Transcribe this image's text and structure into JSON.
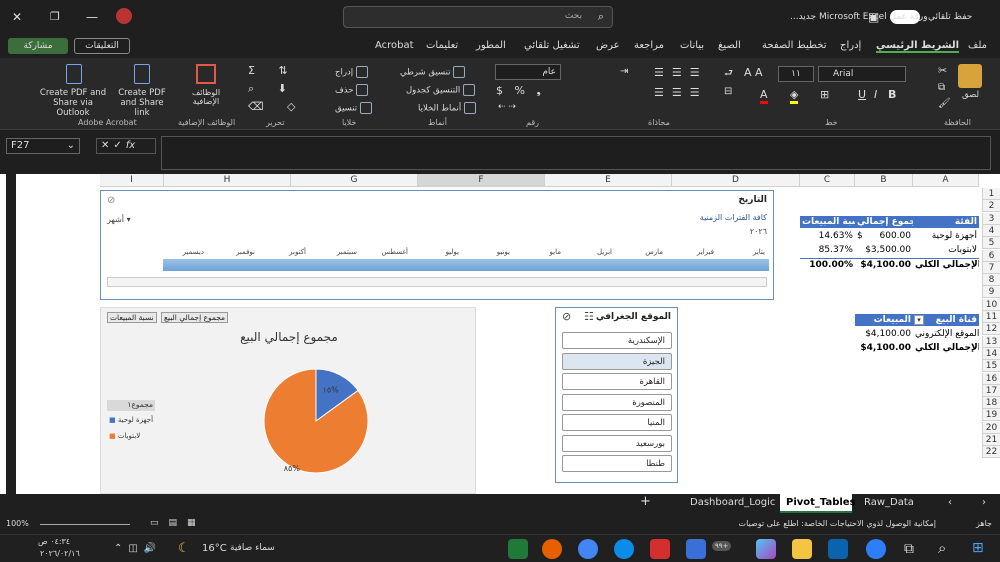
{
  "titlebar": {
    "autosave": "حفظ تلقائي",
    "doc_title": "ورقة عمل Microsoft Excel جديد...",
    "search_placeholder": "بحث"
  },
  "menu": {
    "share": "مشاركة",
    "comments": "التعليقات",
    "tabs": [
      "ملف",
      "الشريط الرئيسي",
      "إدراج",
      "تخطيط الصفحة",
      "الصيغ",
      "بيانات",
      "مراجعة",
      "عرض",
      "تشغيل تلقائي",
      "المطور",
      "تعليمات",
      "Acrobat"
    ]
  },
  "ribbon": {
    "clipboard": {
      "group": "الحافظة",
      "paste": "لصق"
    },
    "font": {
      "group": "خط",
      "name": "Arial",
      "size": "١١"
    },
    "alignment": {
      "group": "محاذاة"
    },
    "number": {
      "group": "رقم",
      "format": "عام"
    },
    "styles": {
      "group": "أنماط",
      "cond": "تنسيق شرطي",
      "table": "التنسيق كجدول",
      "cell": "أنماط الخلايا"
    },
    "cells": {
      "group": "خلايا",
      "insert": "إدراج",
      "delete": "حذف",
      "format": "تنسيق"
    },
    "editing": {
      "group": "تحرير"
    },
    "addins": {
      "group": "الوظائف الإضافية",
      "label": "الوظائف الإضافية"
    },
    "acrobat": {
      "group": "Adobe Acrobat",
      "pdf1": "Create PDF and Share via Outlook",
      "pdf2": "Create PDF and Share link"
    }
  },
  "formula": {
    "namebox": "F27",
    "fx": "fx"
  },
  "columns": [
    "A",
    "B",
    "C",
    "D",
    "E",
    "F",
    "G",
    "H",
    "I"
  ],
  "rows": [
    "1",
    "2",
    "3",
    "4",
    "5",
    "6",
    "7",
    "8",
    "9",
    "10",
    "11",
    "12",
    "13",
    "14",
    "15",
    "16",
    "17",
    "18",
    "19",
    "20",
    "21",
    "22"
  ],
  "pivot1": {
    "h_cat": "الفئة",
    "h_sum": "مجموع إجمالي",
    "h_pct": "نسبة المبيعات",
    "rows": [
      {
        "cat": "أجهزة لوحية",
        "cur": "$",
        "sum": "600.00",
        "pct": "14.63%"
      },
      {
        "cat": "لابتوبات",
        "cur": "",
        "sum": "$3,500.00",
        "pct": "85.37%"
      },
      {
        "cat": "الإجمالي الكلي",
        "cur": "",
        "sum": "$4,100.00",
        "pct": "100.00%"
      }
    ]
  },
  "pivot2": {
    "h_channel": "قناة البيع",
    "h_sales": "المبيعات",
    "rows": [
      {
        "ch": "الموقع الإلكتروني",
        "val": "$4,100.00"
      },
      {
        "ch": "الإجمالي الكلي",
        "val": "$4,100.00"
      }
    ]
  },
  "timeline": {
    "title": "التاريخ",
    "range": "كافة الفترات الزمنية",
    "year": "٢٠٢٦",
    "unit": "أشهر",
    "months": [
      "يناير",
      "فبراير",
      "مارس",
      "ابريل",
      "مايو",
      "يونيو",
      "يوليو",
      "أغسطس",
      "سبتمبر",
      "أكتوبر",
      "نوفمبر",
      "ديسمبر"
    ]
  },
  "slicer": {
    "title": "الموقع الجغرافي",
    "items": [
      "الإسكندرية",
      "الجيزة",
      "القاهرة",
      "المنصورة",
      "المنيا",
      "بورسعيد",
      "طنطا"
    ],
    "selected": "الجيزة"
  },
  "chart_data": {
    "type": "pie",
    "title": "مجموع إجمالي البيع",
    "buttons": [
      "مجموع إجمالي البيع",
      "نسبة المبيعات"
    ],
    "legend_title": "مجموع١",
    "categories": [
      "أجهزة لوحية",
      "لابتوبات"
    ],
    "values": [
      15,
      85
    ],
    "data_labels": [
      "١٥%",
      "٨٥%"
    ],
    "colors": [
      "#4472c4",
      "#ed7d31"
    ],
    "legend_position": "left"
  },
  "sheets": {
    "active": "Pivot_Tables",
    "names": [
      "Dashboard_Logic",
      "Pivot_Tables",
      "Raw_Data"
    ]
  },
  "status": {
    "ready": "جاهز",
    "accessibility": "إمكانية الوصول لذوي الاحتياجات الخاصة: اطلع على توصيات",
    "zoom": "100%"
  },
  "taskbar": {
    "weather_temp": "16°C",
    "weather_text": "سماء صافية",
    "time": "٠٤:٣٤ ص",
    "date": "٢٠٢٦/٠٢/١٦",
    "badge": "٩٩+"
  }
}
